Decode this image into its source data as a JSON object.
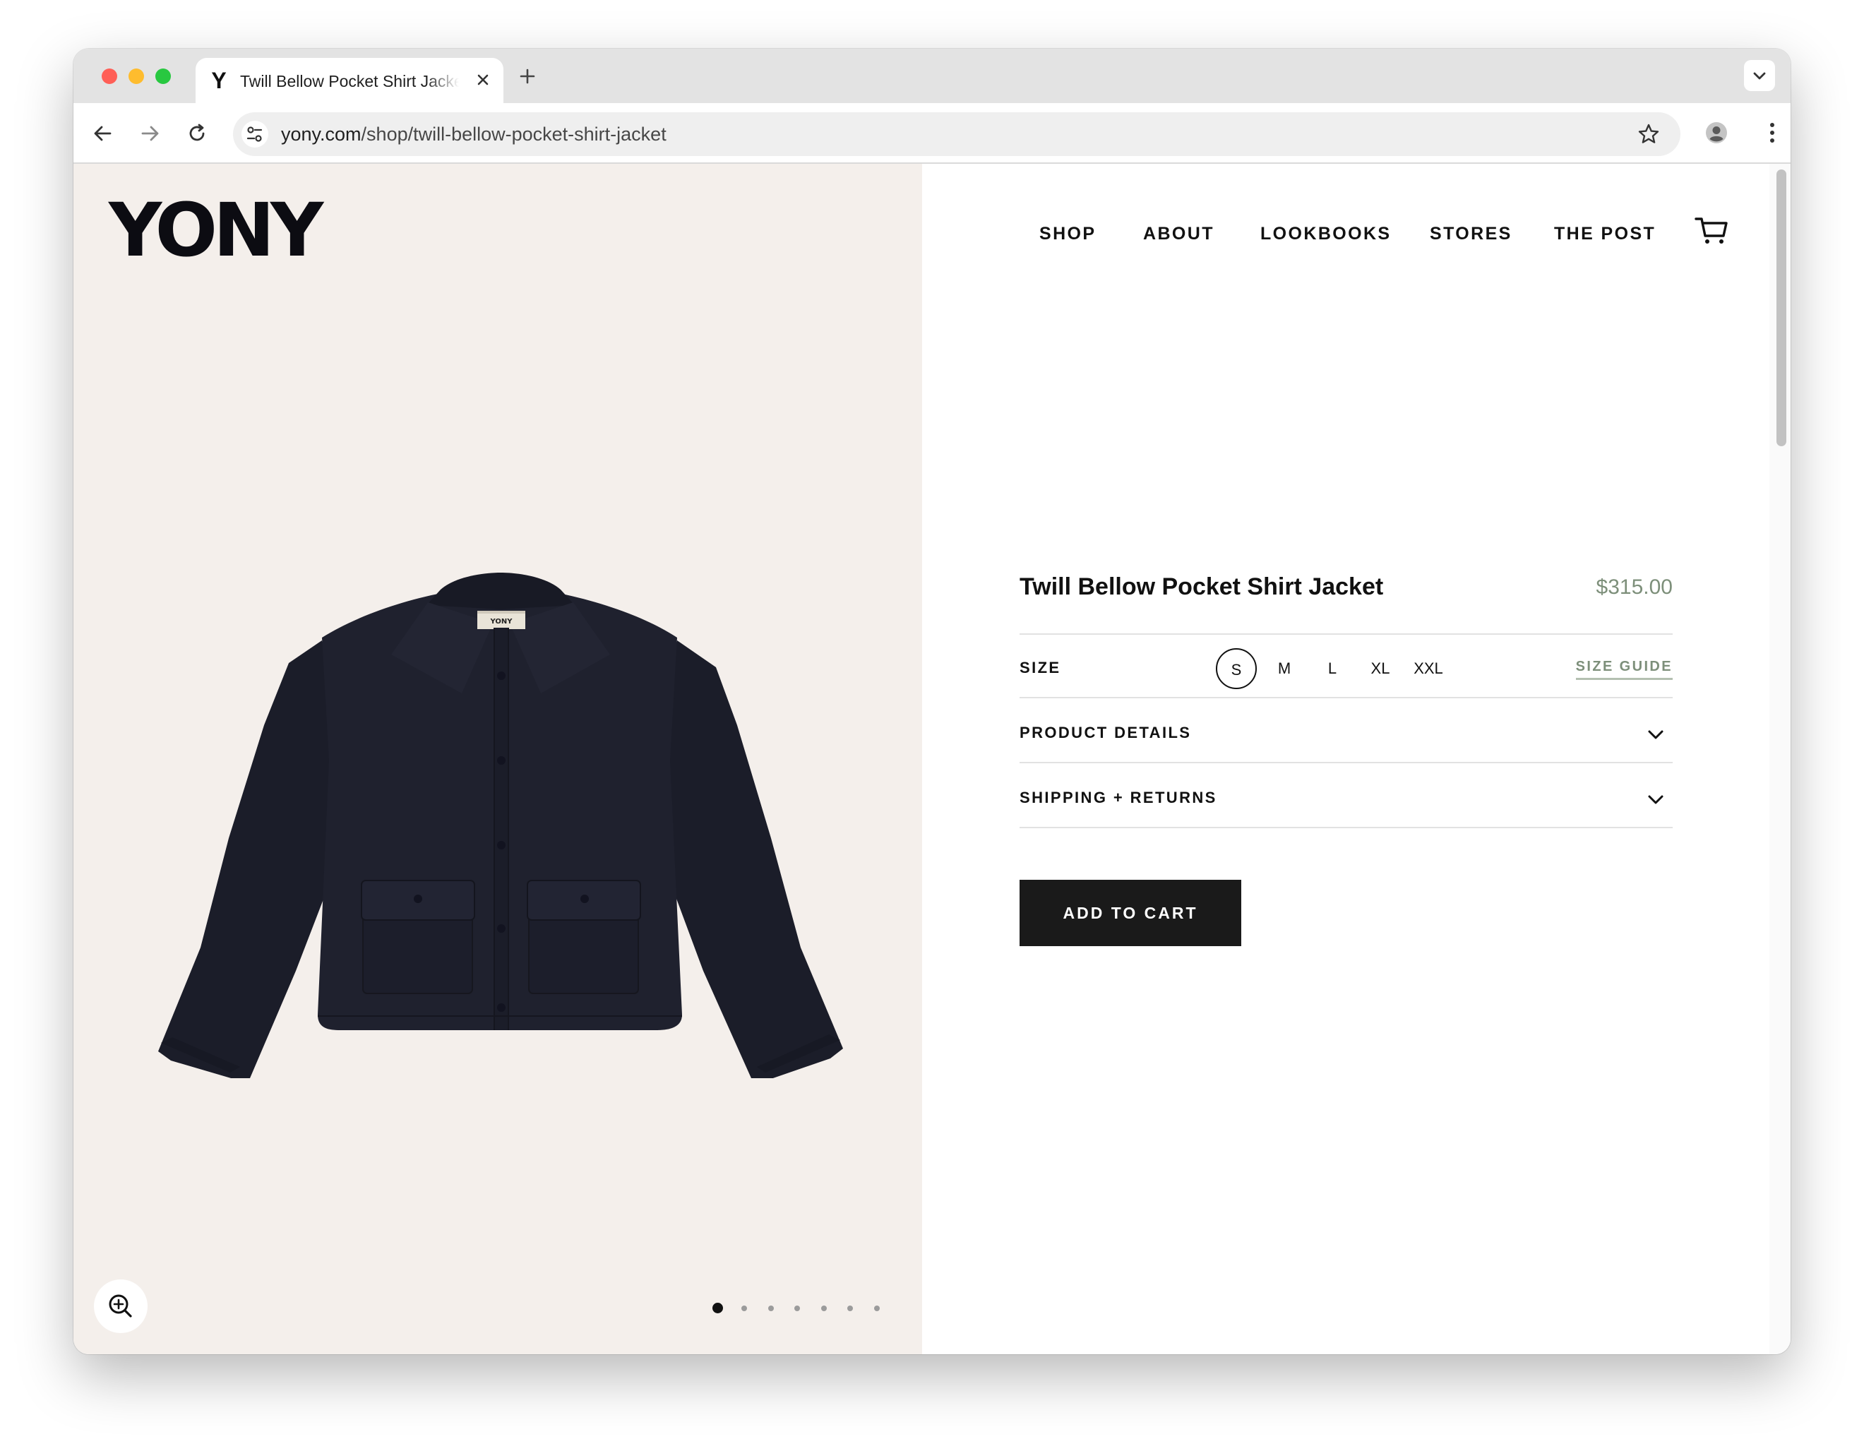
{
  "browser": {
    "tab_title": "Twill Bellow Pocket Shirt Jacket",
    "tab_favicon": "Y",
    "url_domain": "yony.com",
    "url_path": "/shop/twill-bellow-pocket-shirt-jacket"
  },
  "site": {
    "logo": "YONY",
    "nav": [
      "SHOP",
      "ABOUT",
      "LOOKBOOKS",
      "STORES",
      "THE POST"
    ]
  },
  "gallery": {
    "image_count": 7,
    "active_index": 0,
    "label_text": "YONY"
  },
  "product": {
    "title": "Twill Bellow Pocket Shirt Jacket",
    "price": "$315.00",
    "size_label": "SIZE",
    "sizes": [
      "S",
      "M",
      "L",
      "XL",
      "XXL"
    ],
    "selected_size": "S",
    "size_guide": "SIZE GUIDE",
    "details_label": "PRODUCT DETAILS",
    "shipping_label": "SHIPPING + RETURNS",
    "add_to_cart": "ADD TO CART"
  },
  "colors": {
    "image_background": "#f4efeb",
    "price_accent": "#7d8f7a",
    "button": "#1a1a1a",
    "jacket": "#1d1f2c"
  }
}
